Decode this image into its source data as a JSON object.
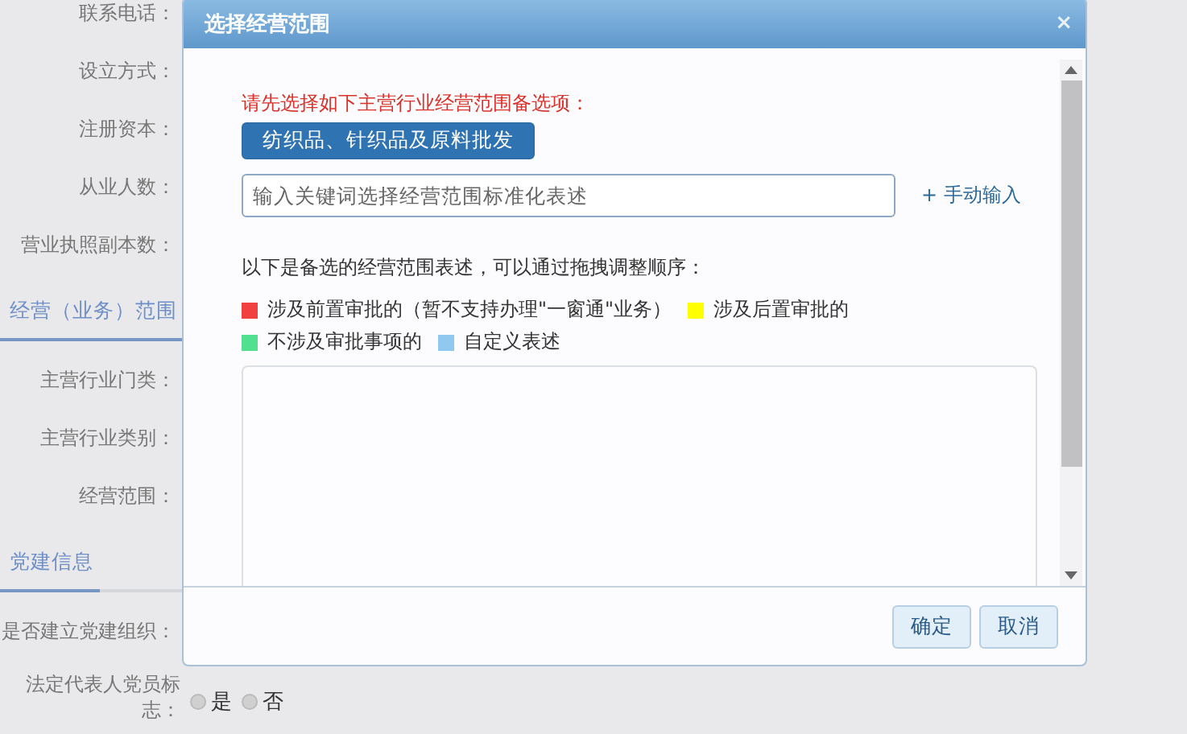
{
  "background_form": {
    "rows": [
      {
        "kind": "label",
        "text": "联系电话："
      },
      {
        "kind": "label",
        "text": "设立方式："
      },
      {
        "kind": "label",
        "text": "注册资本："
      },
      {
        "kind": "label",
        "text": "从业人数："
      },
      {
        "kind": "label",
        "text": "营业执照副本数："
      },
      {
        "kind": "section",
        "text": "经营（业务）范围"
      },
      {
        "kind": "label",
        "text": "主营行业门类："
      },
      {
        "kind": "label",
        "text": "主营行业类别："
      },
      {
        "kind": "label",
        "text": "经营范围："
      },
      {
        "kind": "section",
        "text": "党建信息"
      },
      {
        "kind": "label",
        "text": "是否建立党建组织："
      },
      {
        "kind": "radio",
        "text": "法定代表人党员标志：",
        "options": [
          {
            "label": "是",
            "selected": false
          },
          {
            "label": "否",
            "selected": false
          }
        ]
      }
    ]
  },
  "dialog": {
    "title": "选择经营范围",
    "close": "×",
    "prompt": "请先选择如下主营行业经营范围备选项：",
    "industry_options": [
      {
        "label": "纺织品、针织品及原料批发",
        "selected": true
      }
    ],
    "search": {
      "placeholder": "输入关键词选择经营范围标准化表述"
    },
    "manual_link": "+ 手动输入",
    "hint": "以下是备选的经营范围表述，可以通过拖拽调整顺序：",
    "legend": [
      {
        "label": "涉及前置审批的（暂不支持办理\"一窗通\"业务）",
        "color": "#f04040"
      },
      {
        "label": "涉及后置审批的",
        "color": "#ffff00"
      },
      {
        "label": "不涉及审批事项的",
        "color": "#50e090"
      },
      {
        "label": "自定义表述",
        "color": "#90c8f0"
      }
    ],
    "buttons": [
      "确定",
      "取消"
    ]
  }
}
